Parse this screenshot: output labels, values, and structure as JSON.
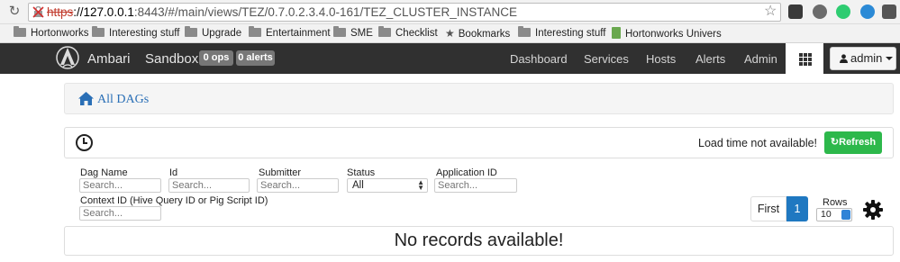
{
  "browser": {
    "url_scheme": "https",
    "url_host": "://127.0.0.1",
    "url_rest": ":8443/#/main/views/TEZ/0.7.0.2.3.4.0-161/TEZ_CLUSTER_INSTANCE",
    "bookmarks": [
      "Hortonworks",
      "Interesting stuff",
      "Upgrade",
      "Entertainment",
      "SME",
      "Checklist",
      "Bookmarks",
      "Interesting stuff",
      "Hortonworks Univers"
    ]
  },
  "navbar": {
    "brand": "Ambari",
    "cluster_name": "Sandbox",
    "ops_badge": "0 ops",
    "alerts_badge": "0 alerts",
    "items": [
      "Dashboard",
      "Services",
      "Hosts",
      "Alerts",
      "Admin"
    ],
    "user": "admin"
  },
  "breadcrumb": {
    "label": "All DAGs"
  },
  "status": {
    "load_time_text": "Load time not available!",
    "refresh_label": "Refresh"
  },
  "filters": {
    "dag_name": {
      "label": "Dag Name",
      "placeholder": "Search..."
    },
    "id": {
      "label": "Id",
      "placeholder": "Search..."
    },
    "submitter": {
      "label": "Submitter",
      "placeholder": "Search..."
    },
    "status": {
      "label": "Status",
      "value": "All"
    },
    "application_id": {
      "label": "Application ID",
      "placeholder": "Search..."
    },
    "context_id": {
      "label": "Context ID (Hive Query ID or Pig Script ID)",
      "placeholder": "Search..."
    }
  },
  "pagination": {
    "first_label": "First",
    "current_page": "1",
    "rows_label": "Rows",
    "rows_value": "10"
  },
  "table": {
    "empty_message": "No records available!"
  },
  "colors": {
    "navbar_bg": "#303030",
    "refresh_green": "#2db84b",
    "page_blue": "#1f78c1",
    "link_blue": "#2a6fb6"
  }
}
